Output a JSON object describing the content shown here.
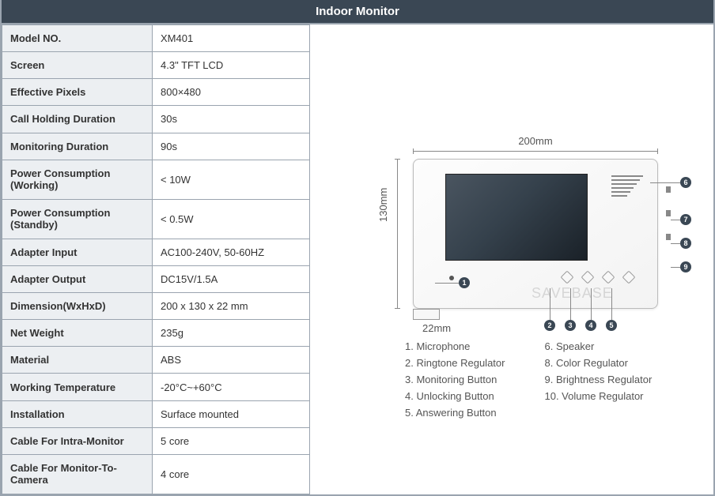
{
  "header": "Indoor Monitor",
  "specs": [
    {
      "label": "Model NO.",
      "value": "XM401"
    },
    {
      "label": "Screen",
      "value": "4.3\" TFT LCD"
    },
    {
      "label": "Effective Pixels",
      "value": "800×480"
    },
    {
      "label": "Call Holding Duration",
      "value": "30s"
    },
    {
      "label": "Monitoring Duration",
      "value": "90s"
    },
    {
      "label": "Power Consumption (Working)",
      "value": "< 10W"
    },
    {
      "label": "Power Consumption (Standby)",
      "value": "< 0.5W"
    },
    {
      "label": "Adapter Input",
      "value": "AC100-240V, 50-60HZ"
    },
    {
      "label": "Adapter Output",
      "value": "DC15V/1.5A"
    },
    {
      "label": "Dimension(WxHxD)",
      "value": "200 x 130 x 22 mm"
    },
    {
      "label": "Net Weight",
      "value": "235g"
    },
    {
      "label": "Material",
      "value": "ABS"
    },
    {
      "label": "Working Temperature",
      "value": "-20°C~+60°C"
    },
    {
      "label": "Installation",
      "value": "Surface mounted"
    },
    {
      "label": "Cable For Intra-Monitor",
      "value": "5 core"
    },
    {
      "label": "Cable For Monitor-To-Camera",
      "value": "4 core"
    }
  ],
  "dimensions": {
    "width": "200mm",
    "height": "130mm",
    "depth": "22mm"
  },
  "markers": {
    "m1": "1",
    "m2": "2",
    "m3": "3",
    "m4": "4",
    "m5": "5",
    "m6": "6",
    "m7": "7",
    "m8": "8",
    "m9": "9"
  },
  "legend": {
    "col1": [
      "1. Microphone",
      "2. Ringtone Regulator",
      "3. Monitoring Button",
      "4. Unlocking Button",
      "5. Answering Button"
    ],
    "col2": [
      "6. Speaker",
      "8. Color Regulator",
      "9. Brightness Regulator",
      "10. Volume Regulator"
    ]
  },
  "watermark": "SAVEBASE"
}
